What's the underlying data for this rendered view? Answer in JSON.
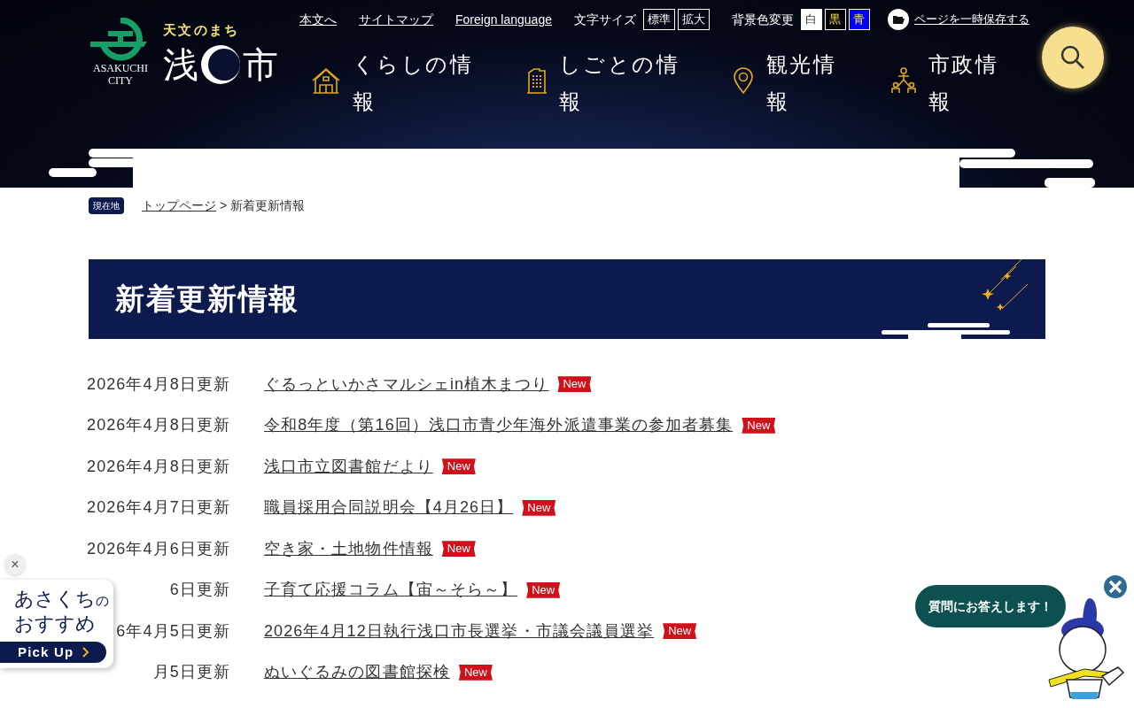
{
  "header": {
    "logo": {
      "city_en": "ASAKUCHI CITY",
      "tagline": "天文のまち",
      "name_left": "浅",
      "name_right": "市"
    },
    "utility_links": [
      "本文へ",
      "サイトマップ",
      "Foreign language"
    ],
    "font_size": {
      "label": "文字サイズ",
      "options": [
        {
          "label": "標準"
        },
        {
          "label": "拡大"
        }
      ]
    },
    "bg_color": {
      "label": "背景色変更",
      "options": [
        {
          "label": "白",
          "color": "#ffffff"
        },
        {
          "label": "黒",
          "color": "#000000"
        },
        {
          "label": "青",
          "color": "#0000ff"
        }
      ]
    },
    "save_link": "ページを一時保存する",
    "nav": [
      {
        "label": "くらしの情報",
        "kind": "house"
      },
      {
        "label": "しごとの情報",
        "kind": "building"
      },
      {
        "label": "観光情報",
        "kind": "pin"
      },
      {
        "label": "市政情報",
        "kind": "people"
      }
    ]
  },
  "breadcrumb": {
    "badge": "現在地",
    "separator": ">",
    "items": [
      {
        "label": "トップページ",
        "kind": "link"
      },
      {
        "label": "新着更新情報",
        "kind": "current"
      }
    ]
  },
  "page_title": "新着更新情報",
  "news": [
    {
      "date": "2026年4月8日更新",
      "title": "ぐるっといかさマルシェin植木まつり",
      "badge": "New"
    },
    {
      "date": "2026年4月8日更新",
      "title": "令和8年度（第16回）浅口市青少年海外派遣事業の参加者募集",
      "badge": "New"
    },
    {
      "date": "2026年4月8日更新",
      "title": "浅口市立図書館だより",
      "badge": "New"
    },
    {
      "date": "2026年4月7日更新",
      "title": "職員採用合同説明会【4月26日】",
      "badge": "New"
    },
    {
      "date": "2026年4月6日更新",
      "title": "空き家・土地物件情報",
      "badge": "New"
    },
    {
      "date": "6日更新",
      "title": "子育て応援コラム【宙～そら～】",
      "badge": "New"
    },
    {
      "date": "6年4月5日更新",
      "title": "2026年4月12日執行浅口市長選挙・市議会議員選挙",
      "badge": "New"
    },
    {
      "date": "月5日更新",
      "title": "ぬいぐるみの図書館探検",
      "badge": "New"
    }
  ],
  "pickup_banner": {
    "close": "×",
    "line1": "あさくち",
    "line1_suffix": "の",
    "line2": "おすすめ",
    "button": "Pick Up"
  },
  "chat_widget": {
    "bubble": "質問にお答えします！"
  }
}
